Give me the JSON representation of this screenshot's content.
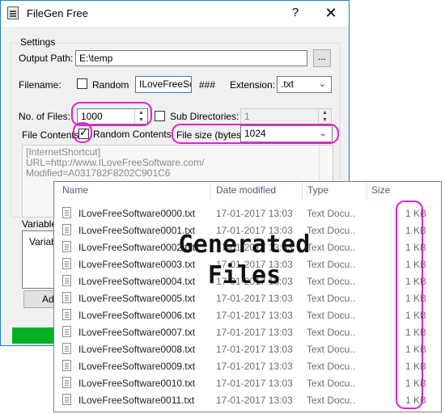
{
  "window": {
    "title": "FileGen Free",
    "help": "?",
    "close": "✕"
  },
  "settings": {
    "group_label": "Settings",
    "output_path_label": "Output Path:",
    "output_path_value": "E:\\temp",
    "browse_label": "...",
    "filename_label": "Filename:",
    "random_label": "Random",
    "random_checked": false,
    "filename_value": "ILoveFreeSof",
    "hash_pattern": "###",
    "extension_label": "Extension:",
    "extension_value": ".txt",
    "num_files_label": "No. of Files:",
    "num_files_value": "1000",
    "subdirs_label": "Sub Directories:",
    "subdirs_checked": false,
    "subdirs_value": "1",
    "file_contents_label": "File Contents",
    "random_contents_label": "Random Contents",
    "random_contents_checked": true,
    "file_size_label": "File size (bytes):",
    "file_size_value": "1024",
    "contents_lines": [
      "[InternetShortcut]",
      "URL=http://www.ILoveFreeSoftware.com/",
      "Modified=A031782F8202C901C6"
    ]
  },
  "variables": {
    "label": "Variables",
    "list_item": "Variabl",
    "add_button": "Add"
  },
  "progress": {
    "fraction": 0.14,
    "color": "#06b025"
  },
  "highlight_color": "#e020d0",
  "explorer": {
    "columns": {
      "name": "Name",
      "date": "Date modified",
      "type": "Type",
      "size": "Size"
    },
    "files": [
      {
        "name": "ILoveFreeSoftware0000.txt",
        "date": "17-01-2017 13:03",
        "type": "Text Docu...",
        "size": "1 KB"
      },
      {
        "name": "ILoveFreeSoftware0001.txt",
        "date": "17-01-2017 13:03",
        "type": "Text Docu...",
        "size": "1 KB"
      },
      {
        "name": "ILoveFreeSoftware0002.txt",
        "date": "17-01-2017 13:03",
        "type": "Text Docu...",
        "size": "1 KB"
      },
      {
        "name": "ILoveFreeSoftware0003.txt",
        "date": "17-01-2017 13:03",
        "type": "Text Docu...",
        "size": "1 KB"
      },
      {
        "name": "ILoveFreeSoftware0004.txt",
        "date": "17-01-2017 13:03",
        "type": "Text Docu...",
        "size": "1 KB"
      },
      {
        "name": "ILoveFreeSoftware0005.txt",
        "date": "17-01-2017 13:03",
        "type": "Text Docu...",
        "size": "1 KB"
      },
      {
        "name": "ILoveFreeSoftware0006.txt",
        "date": "17-01-2017 13:03",
        "type": "Text Docu...",
        "size": "1 KB"
      },
      {
        "name": "ILoveFreeSoftware0007.txt",
        "date": "17-01-2017 13:03",
        "type": "Text Docu...",
        "size": "1 KB"
      },
      {
        "name": "ILoveFreeSoftware0008.txt",
        "date": "17-01-2017 13:03",
        "type": "Text Docu...",
        "size": "1 KB"
      },
      {
        "name": "ILoveFreeSoftware0009.txt",
        "date": "17-01-2017 13:03",
        "type": "Text Docu...",
        "size": "1 KB"
      },
      {
        "name": "ILoveFreeSoftware0010.txt",
        "date": "17-01-2017 13:03",
        "type": "Text Docu...",
        "size": "1 KB"
      },
      {
        "name": "ILoveFreeSoftware0011.txt",
        "date": "17-01-2017 13:03",
        "type": "Text Docu...",
        "size": "1 KB"
      }
    ]
  },
  "overlay": {
    "line1": "Generated",
    "line2": "Files"
  }
}
